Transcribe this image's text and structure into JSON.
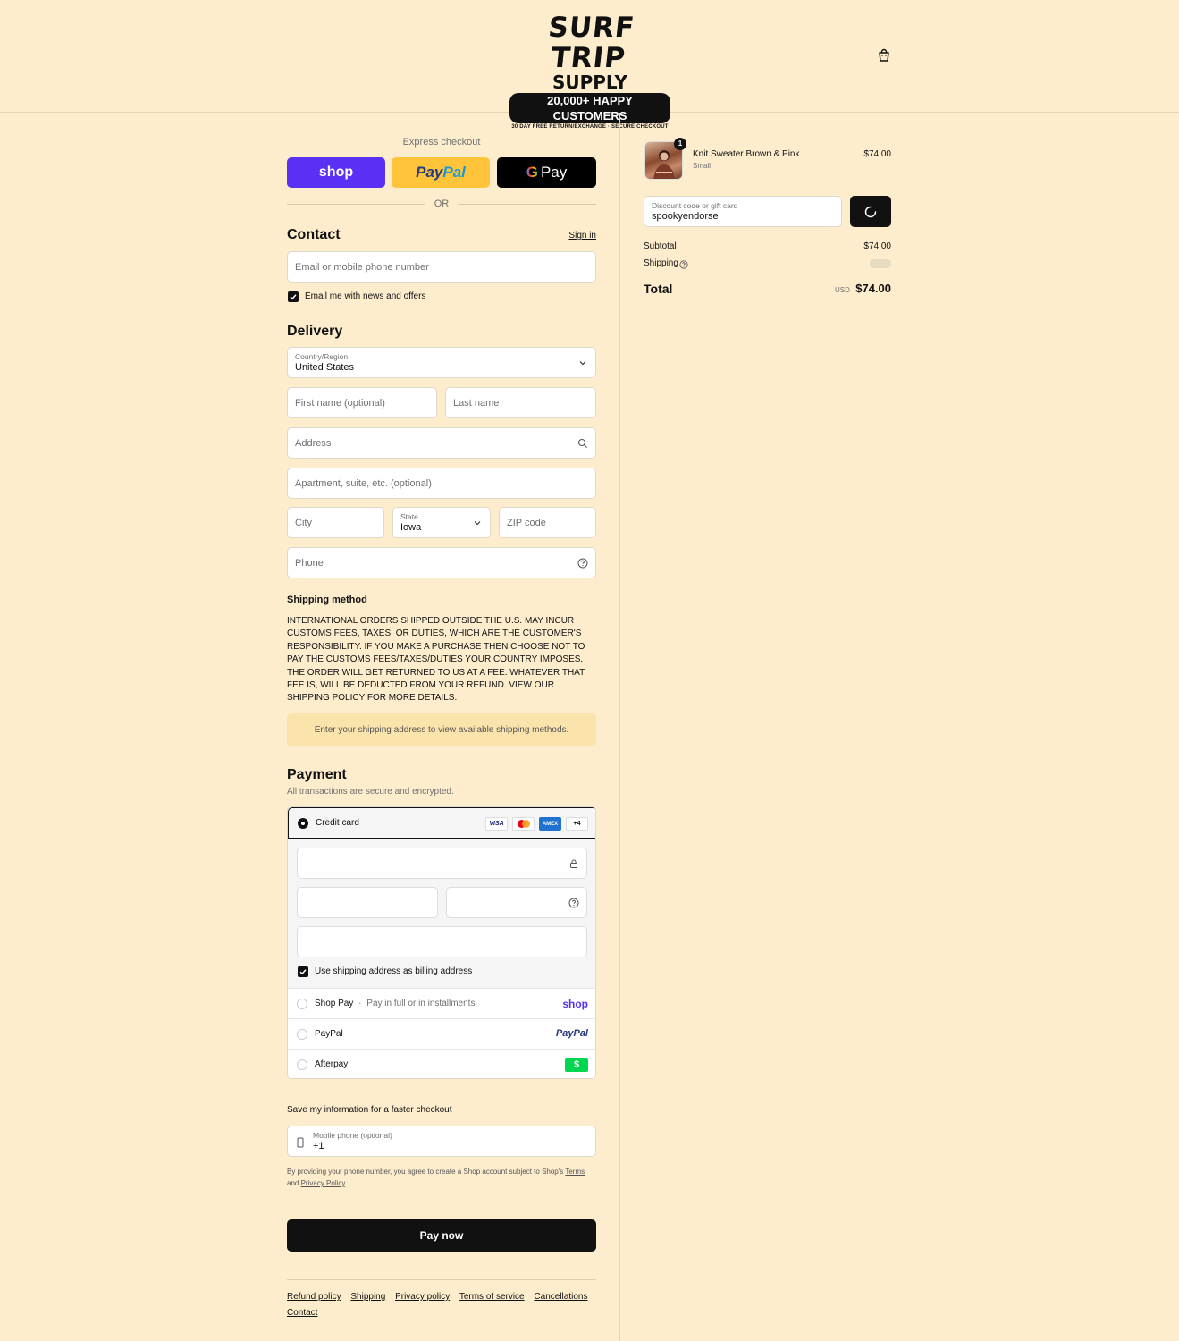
{
  "header": {
    "logo_line1": "SURF TRIP",
    "logo_line2": "SUPPLY",
    "logo_badge": "20,000+ HAPPY CUSTOMERS",
    "logo_small": "30 DAY FREE RETURN/EXCHANGE · SECURE CHECKOUT",
    "cart_icon": "shopping-bag-icon"
  },
  "express": {
    "title": "Express checkout",
    "shop_label": "shop",
    "paypal_label_1": "Pay",
    "paypal_label_2": "Pal",
    "gpay_g": "G",
    "gpay_label": "Pay",
    "or_label": "OR"
  },
  "contact": {
    "heading": "Contact",
    "sign_in": "Sign in",
    "email_placeholder": "Email or mobile phone number",
    "news_label": "Email me with news and offers",
    "news_checked": true
  },
  "delivery": {
    "heading": "Delivery",
    "country_label": "Country/Region",
    "country_value": "United States",
    "first_name_placeholder": "First name (optional)",
    "last_name_placeholder": "Last name",
    "address_placeholder": "Address",
    "apartment_placeholder": "Apartment, suite, etc. (optional)",
    "city_placeholder": "City",
    "state_label": "State",
    "state_value": "Iowa",
    "zip_placeholder": "ZIP code",
    "phone_placeholder": "Phone"
  },
  "shipping_method": {
    "heading": "Shipping method",
    "text": "INTERNATIONAL ORDERS SHIPPED OUTSIDE THE U.S. MAY INCUR CUSTOMS FEES, TAXES, OR DUTIES, WHICH ARE THE CUSTOMER'S RESPONSIBILITY. IF YOU MAKE A PURCHASE THEN CHOOSE NOT TO PAY THE CUSTOMS FEES/TAXES/DUTIES YOUR COUNTRY IMPOSES, THE ORDER WILL GET RETURNED TO US AT A FEE. WHATEVER THAT FEE IS, WILL BE DEDUCTED FROM YOUR REFUND. VIEW OUR SHIPPING POLICY FOR MORE DETAILS.",
    "notice": "Enter your shipping address to view available shipping methods."
  },
  "payment": {
    "heading": "Payment",
    "subtitle": "All transactions are secure and encrypted.",
    "credit_card_label": "Credit card",
    "card_brands": [
      "VISA",
      "MC",
      "AMEX"
    ],
    "more_cards": "+4",
    "billing_label": "Use shipping address as billing address",
    "billing_checked": true,
    "shop_pay_label": "Shop Pay",
    "shop_pay_sub": "Pay in full or in installments",
    "shop_pay_logo": "shop",
    "paypal_label": "PayPal",
    "paypal_logo": "PayPal",
    "afterpay_label": "Afterpay",
    "afterpay_logo": "$"
  },
  "save_info": {
    "heading": "Save my information for a faster checkout",
    "phone_label": "Mobile phone (optional)",
    "phone_value": "+1",
    "legal_1": "By providing your phone number, you agree to create a Shop account subject to Shop's",
    "legal_terms": "Terms",
    "legal_and": "and",
    "legal_privacy": "Privacy Policy",
    "legal_end": "."
  },
  "pay_now": "Pay now",
  "footer_links": [
    "Refund policy",
    "Shipping",
    "Privacy policy",
    "Terms of service",
    "Cancellations",
    "Contact"
  ],
  "summary": {
    "item_name": "Knit Sweater Brown & Pink",
    "item_variant": "Small",
    "item_price": "$74.00",
    "item_qty": "1",
    "discount_label": "Discount code or gift card",
    "discount_value": "spookyendorse",
    "subtotal_label": "Subtotal",
    "subtotal_value": "$74.00",
    "shipping_label": "Shipping",
    "total_label": "Total",
    "currency": "USD",
    "total_value": "$74.00"
  }
}
